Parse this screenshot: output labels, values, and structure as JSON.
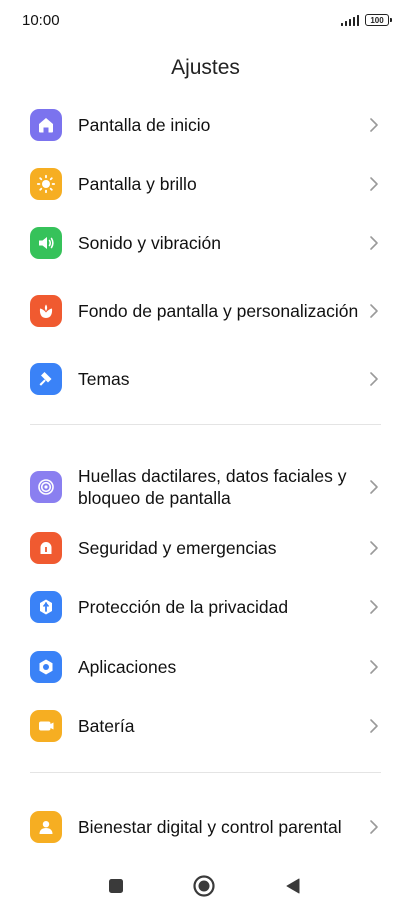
{
  "status": {
    "time": "10:00",
    "battery": "100"
  },
  "header": {
    "title": "Ajustes"
  },
  "groups": [
    {
      "items": [
        {
          "label": "Pantalla de inicio",
          "icon": "home-icon",
          "color": "#7b73ee"
        },
        {
          "label": "Pantalla y brillo",
          "icon": "sun-icon",
          "color": "#f6ae22"
        },
        {
          "label": "Sonido y vibración",
          "icon": "speaker-icon",
          "color": "#36c25a"
        },
        {
          "label": "Fondo de pantalla y personalización",
          "icon": "flower-icon",
          "color": "#f05a30"
        },
        {
          "label": "Temas",
          "icon": "brush-icon",
          "color": "#3a82f7"
        }
      ]
    },
    {
      "items": [
        {
          "label": "Huellas dactilares, datos faciales y bloqueo de pantalla",
          "icon": "fingerprint-icon",
          "color": "#8a7ff0"
        },
        {
          "label": "Seguridad y emergencias",
          "icon": "emergency-icon",
          "color": "#f05a30"
        },
        {
          "label": "Protección de la privacidad",
          "icon": "privacy-icon",
          "color": "#3a82f7"
        },
        {
          "label": "Aplicaciones",
          "icon": "apps-gear-icon",
          "color": "#3a82f7"
        },
        {
          "label": "Batería",
          "icon": "battery-icon",
          "color": "#f6ae22"
        }
      ]
    },
    {
      "items": [
        {
          "label": "Bienestar digital y control parental",
          "icon": "wellbeing-icon",
          "color": "#f6ae22"
        }
      ]
    }
  ],
  "nav": {
    "recents": "square-icon",
    "home": "circle-icon",
    "back": "triangle-back-icon"
  }
}
